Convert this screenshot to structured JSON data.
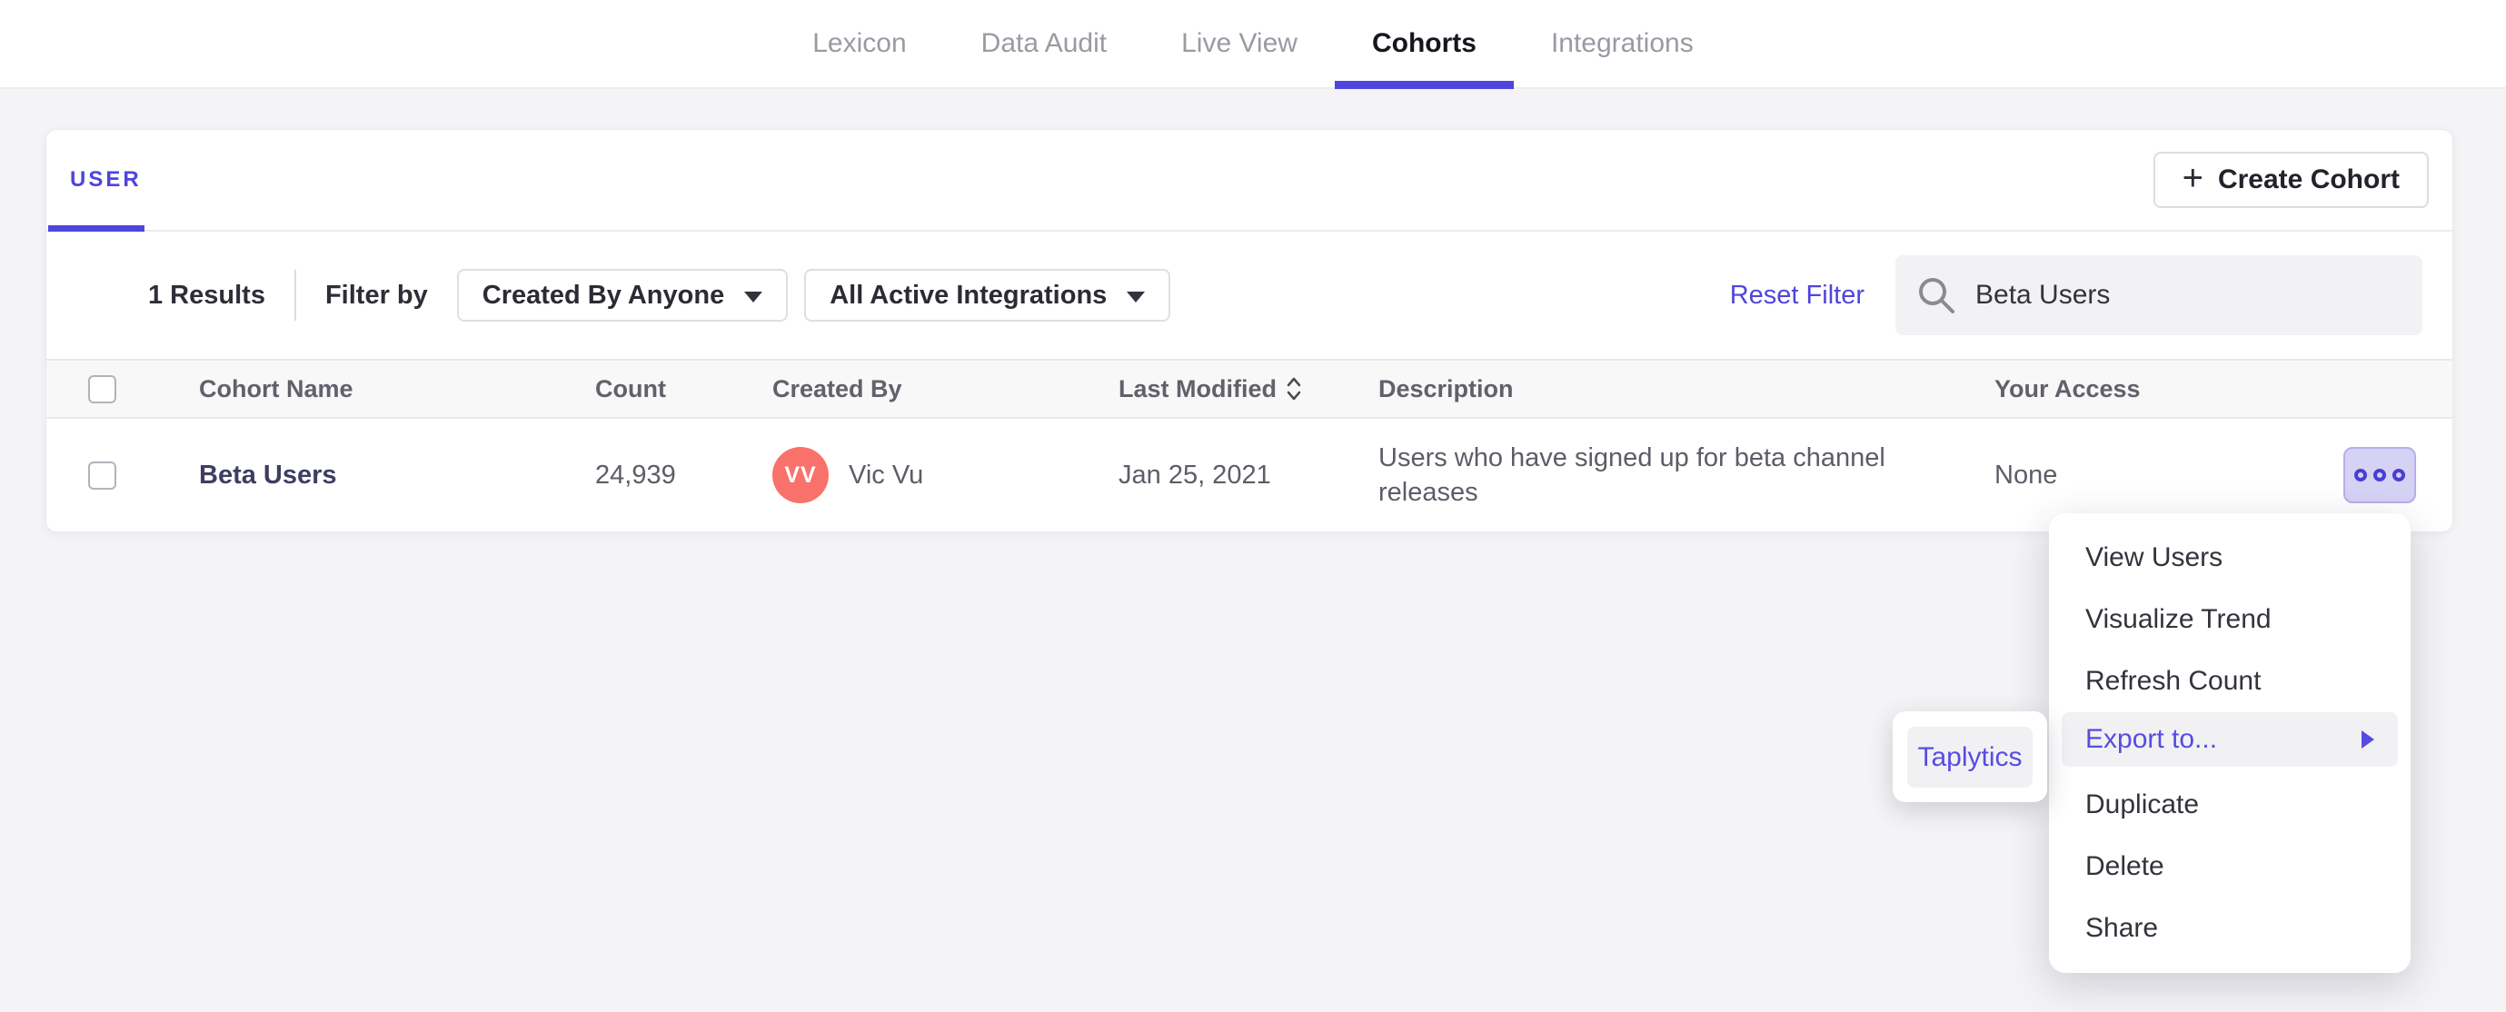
{
  "nav": {
    "tabs": [
      {
        "label": "Lexicon"
      },
      {
        "label": "Data Audit"
      },
      {
        "label": "Live View"
      },
      {
        "label": "Cohorts"
      },
      {
        "label": "Integrations"
      }
    ],
    "active_tab": "Cohorts"
  },
  "panel": {
    "tab_label": "USER",
    "create_button": {
      "plus": "+",
      "label": "Create Cohort"
    },
    "filters": {
      "results_count": "1 Results",
      "filter_by_label": "Filter by",
      "created_by_dropdown": {
        "value": "Created By Anyone"
      },
      "integrations_dropdown": {
        "value": "All Active Integrations"
      },
      "reset_label": "Reset Filter",
      "search": {
        "value": "Beta Users"
      }
    },
    "table": {
      "columns": [
        "Cohort Name",
        "Count",
        "Created By",
        "Last Modified",
        "Description",
        "Your Access"
      ],
      "sorted_column": "Last Modified",
      "row": {
        "name": "Beta Users",
        "count": "24,939",
        "avatar_initials": "VV",
        "created_by": "Vic Vu",
        "last_modified": "Jan 25, 2021",
        "description": "Users who have signed up for beta channel releases",
        "access": "None"
      }
    }
  },
  "context_menu": {
    "items": [
      {
        "label": "View Users"
      },
      {
        "label": "Visualize Trend"
      },
      {
        "label": "Refresh Count"
      },
      {
        "label": "Export to...",
        "highlighted": true,
        "has_submenu": true
      },
      {
        "label": "Duplicate"
      },
      {
        "label": "Delete"
      },
      {
        "label": "Share"
      }
    ],
    "submenu": {
      "items": [
        {
          "label": "Taplytics"
        }
      ]
    }
  },
  "colors": {
    "accent": "#4f44dd",
    "menu_highlight_text": "#574ce2",
    "menu_highlight_bg": "#f1f1f4",
    "avatar_bg": "#f9716b",
    "cohort_name_text": "#3e3e63",
    "dots_button_bg": "#d6d2f4",
    "dots_button_border": "#b6afec",
    "page_bg": "#f4f4f6",
    "header_row_bg": "#f8f8f9"
  }
}
